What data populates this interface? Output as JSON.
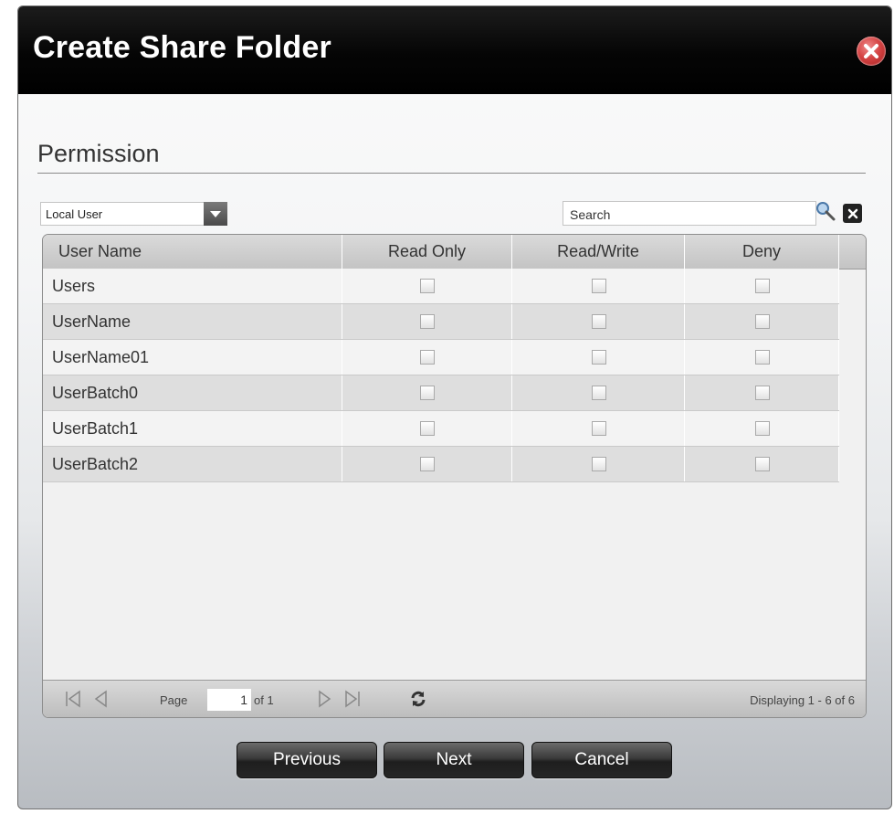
{
  "dialog": {
    "title": "Create Share Folder",
    "section_title": "Permission"
  },
  "filter": {
    "user_type": "Local User",
    "search_placeholder": "Search"
  },
  "table": {
    "columns": [
      "User Name",
      "Read Only",
      "Read/Write",
      "Deny"
    ],
    "rows": [
      {
        "name": "Users",
        "read_only": false,
        "read_write": false,
        "deny": false
      },
      {
        "name": "UserName",
        "read_only": false,
        "read_write": false,
        "deny": false
      },
      {
        "name": "UserName01",
        "read_only": false,
        "read_write": false,
        "deny": false
      },
      {
        "name": "UserBatch0",
        "read_only": false,
        "read_write": false,
        "deny": false
      },
      {
        "name": "UserBatch1",
        "read_only": false,
        "read_write": false,
        "deny": false
      },
      {
        "name": "UserBatch2",
        "read_only": false,
        "read_write": false,
        "deny": false
      }
    ]
  },
  "pager": {
    "page_label": "Page",
    "current_page": "1",
    "of_label": "of 1",
    "display_info": "Displaying 1 - 6 of 6"
  },
  "buttons": {
    "previous": "Previous",
    "next": "Next",
    "cancel": "Cancel"
  },
  "icons": {
    "close": "close-icon",
    "dropdown": "chevron-down-icon",
    "search": "search-icon",
    "clear": "clear-icon",
    "first": "first-page-icon",
    "prev": "prev-page-icon",
    "next": "next-page-icon",
    "last": "last-page-icon",
    "refresh": "refresh-icon"
  },
  "colors": {
    "titlebar": "#000000",
    "close": "#d44343",
    "button": "#2a2a2a"
  }
}
